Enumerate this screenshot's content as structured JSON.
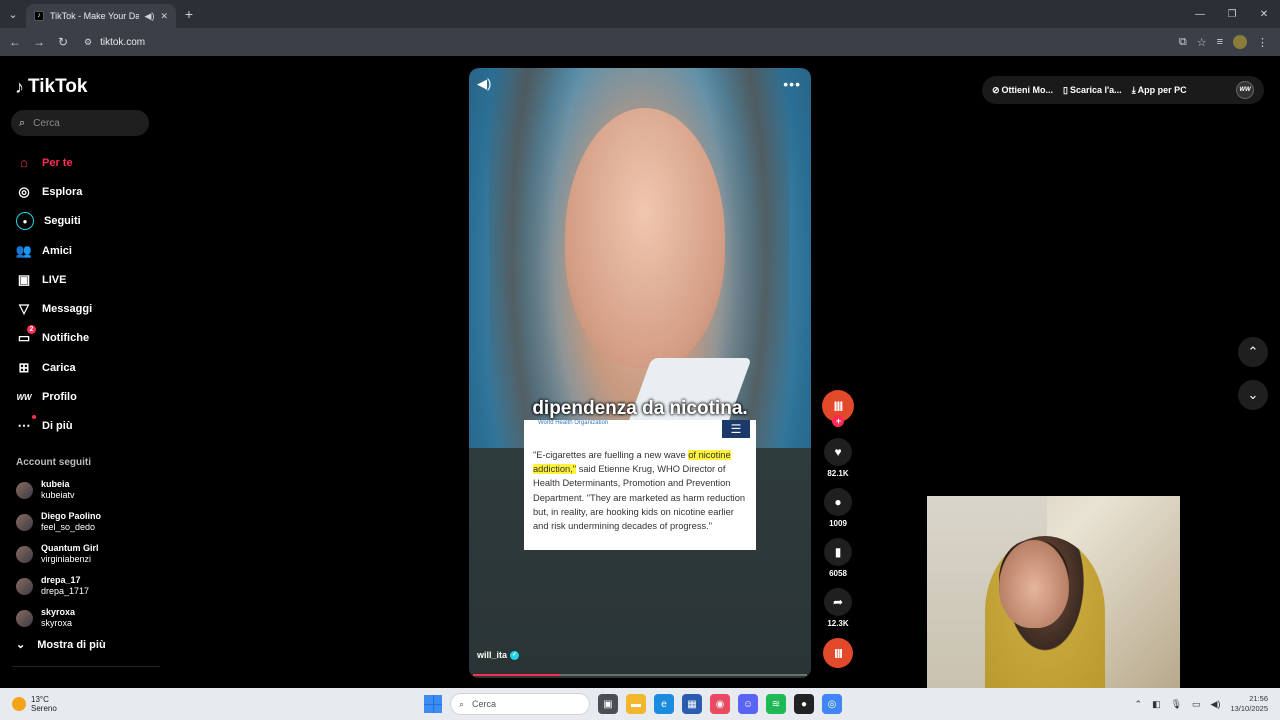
{
  "browser": {
    "tab_title": "TikTok - Make Your Day",
    "url": "tiktok.com"
  },
  "sidebar": {
    "logo": "TikTok",
    "search_placeholder": "Cerca",
    "nav": [
      {
        "label": "Per te",
        "icon": "home-icon"
      },
      {
        "label": "Esplora",
        "icon": "compass-icon"
      },
      {
        "label": "Seguiti",
        "icon": "following-icon"
      },
      {
        "label": "Amici",
        "icon": "friends-icon"
      },
      {
        "label": "LIVE",
        "icon": "live-icon"
      },
      {
        "label": "Messaggi",
        "icon": "messages-icon"
      },
      {
        "label": "Notifiche",
        "icon": "notifications-icon",
        "badge": "2"
      },
      {
        "label": "Carica",
        "icon": "upload-icon"
      },
      {
        "label": "Profilo",
        "icon": "profile-icon"
      },
      {
        "label": "Di più",
        "icon": "more-icon"
      }
    ],
    "followed_title": "Account seguiti",
    "accounts": [
      {
        "name": "kubeia",
        "handle": "kubeiatv"
      },
      {
        "name": "Diego Paolino",
        "handle": "feel_so_dedo"
      },
      {
        "name": "Quantum Girl",
        "handle": "virginiabenzi"
      },
      {
        "name": "drepa_17",
        "handle": "drepa_1717"
      },
      {
        "name": "skyroxa",
        "handle": "skyroxa"
      }
    ],
    "show_more": "Mostra di più"
  },
  "video": {
    "caption": "dipendenza da nicotina.",
    "article_org": "World Health Organization",
    "quote_before": "\"E-cigarettes are fuelling a new wave ",
    "quote_highlight": "of nicotine addiction,\"",
    "quote_after": " said Etienne Krug, WHO Director of Health Determinants, Promotion and Prevention Department. \"They are marketed as harm reduction but, in reality, are hooking kids on nicotine earlier and risk undermining decades of progress.\"",
    "author": "will_ita",
    "progress": 0.26
  },
  "actions": {
    "likes": "82.1K",
    "comments": "1009",
    "saves": "6058",
    "shares": "12.3K"
  },
  "top_right": {
    "coins": "Ottieni Mo...",
    "download": "Scarica l'a...",
    "app_pc": "App per PC"
  },
  "taskbar": {
    "temp": "13°C",
    "weather": "Sereno",
    "search": "Cerca",
    "time": "21:56",
    "date": "13/10/2025"
  }
}
